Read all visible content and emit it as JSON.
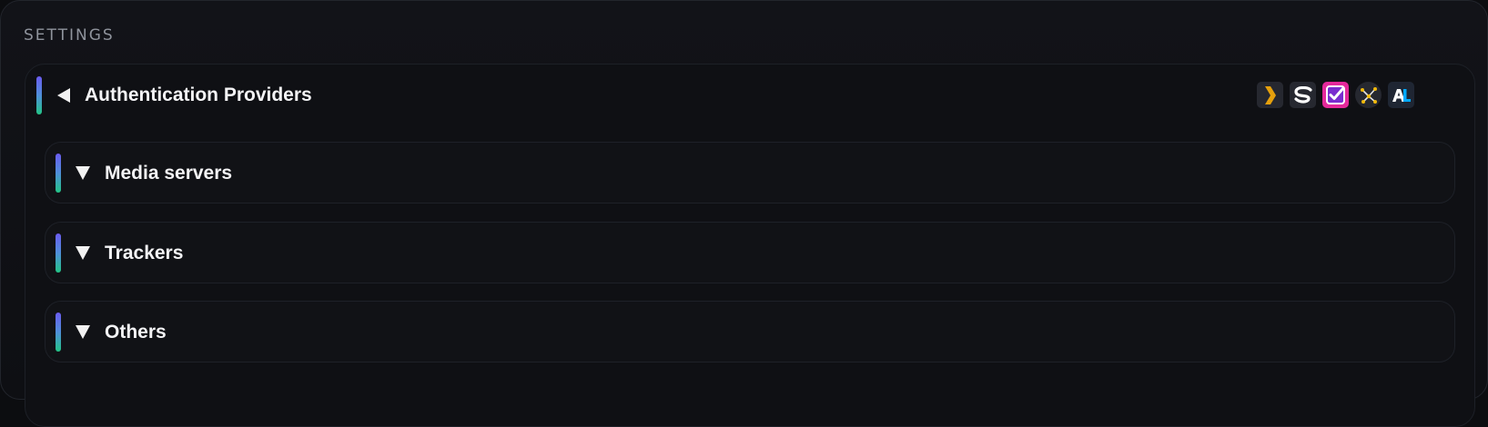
{
  "settings": {
    "heading": "SETTINGS"
  },
  "auth_providers": {
    "title": "Authentication Providers",
    "expanded": true,
    "provider_icons": [
      {
        "name": "plex-icon",
        "color": "#e5a00d"
      },
      {
        "name": "simkl-icon",
        "color": "#ffffff"
      },
      {
        "name": "mdblist-check-icon",
        "color": "#e4299b"
      },
      {
        "name": "trakt-network-icon",
        "color": "#f0b90b"
      },
      {
        "name": "anilist-icon",
        "color": "#02a9ff"
      }
    ],
    "sections": [
      {
        "title": "Media servers",
        "expanded": false
      },
      {
        "title": "Trackers",
        "expanded": false
      },
      {
        "title": "Others",
        "expanded": false
      }
    ]
  },
  "colors": {
    "background": "#0c0d10",
    "accent_top": "#6b5cf0",
    "accent_bottom": "#23c586",
    "text": "#f3f3f5",
    "muted": "#8f939c"
  }
}
